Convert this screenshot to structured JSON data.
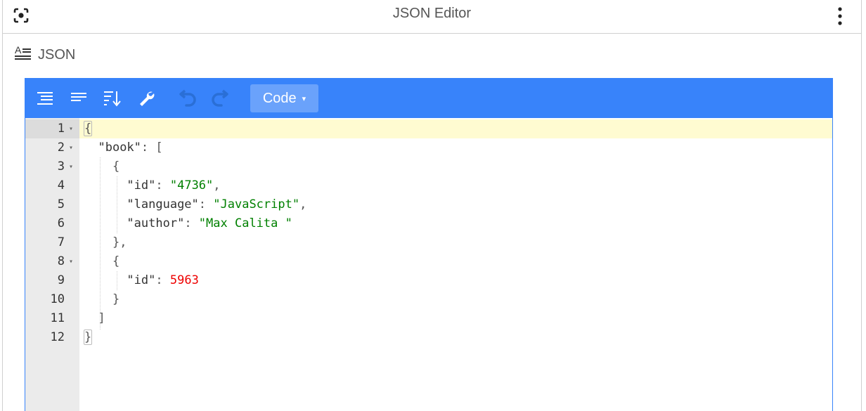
{
  "window": {
    "title": "JSON Editor",
    "left_icon": "focus-frame-icon",
    "right_icon": "more-vert-icon"
  },
  "section": {
    "icon": "text-format-icon",
    "label": "JSON"
  },
  "toolbar": {
    "buttons": [
      {
        "name": "format-icon"
      },
      {
        "name": "compact-icon"
      },
      {
        "name": "sort-icon"
      },
      {
        "name": "transform-icon"
      },
      {
        "name": "undo-icon"
      },
      {
        "name": "redo-icon"
      }
    ],
    "mode_label": "Code",
    "mode_caret": "▾",
    "accent": "#3883fa"
  },
  "editor": {
    "lines": [
      {
        "num": "1",
        "fold": "▾"
      },
      {
        "num": "2",
        "fold": "▾"
      },
      {
        "num": "3",
        "fold": "▾"
      },
      {
        "num": "4",
        "fold": ""
      },
      {
        "num": "5",
        "fold": ""
      },
      {
        "num": "6",
        "fold": ""
      },
      {
        "num": "7",
        "fold": ""
      },
      {
        "num": "8",
        "fold": "▾"
      },
      {
        "num": "9",
        "fold": ""
      },
      {
        "num": "10",
        "fold": ""
      },
      {
        "num": "11",
        "fold": ""
      },
      {
        "num": "12",
        "fold": ""
      }
    ],
    "tokens": {
      "l1_open": "{",
      "l2_key": "\"book\"",
      "l2_colon": ": ",
      "l2_open": "[",
      "l3_open": "{",
      "l4_key": "\"id\"",
      "l4_colon": ": ",
      "l4_val": "\"4736\"",
      "l4_comma": ",",
      "l5_key": "\"language\"",
      "l5_colon": ": ",
      "l5_val": "\"JavaScript\"",
      "l5_comma": ",",
      "l6_key": "\"author\"",
      "l6_colon": ": ",
      "l6_val": "\"Max Calita \"",
      "l7_close": "},",
      "l8_open": "{",
      "l9_key": "\"id\"",
      "l9_colon": ": ",
      "l9_val": "5963",
      "l10_close": "}",
      "l11_close": "]",
      "l12_close": "}"
    },
    "colors": {
      "string": "#008000",
      "number": "#ee0000",
      "active_line": "#fffbd1"
    }
  }
}
